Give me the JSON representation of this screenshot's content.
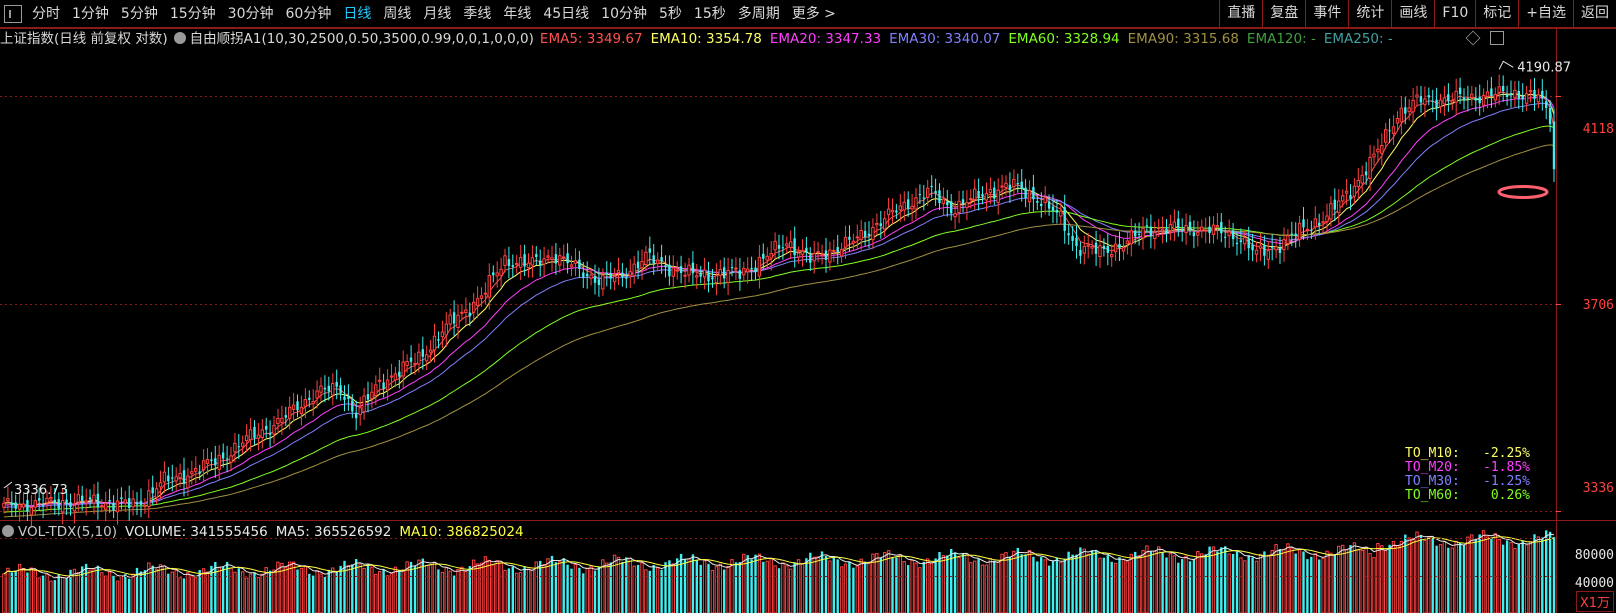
{
  "toolbar": {
    "timeframes": [
      "分时",
      "1分钟",
      "5分钟",
      "15分钟",
      "30分钟",
      "60分钟",
      "日线",
      "周线",
      "月线",
      "季线",
      "年线",
      "45日线",
      "10分钟",
      "5秒",
      "15秒",
      "多周期",
      "更多 >"
    ],
    "active_timeframe": "日线",
    "right_buttons": [
      "直播",
      "复盘",
      "事件",
      "统计",
      "画线",
      "F10",
      "标记",
      "+自选",
      "返回"
    ]
  },
  "main": {
    "security_label": "上证指数(日线 前复权 对数)",
    "indicator_label": "自由顺拐A1(10,30,2500,0.50,3500,0.99,0,0,1,0,0,0)",
    "ema_legend": [
      {
        "label": "EMA5: 3349.67",
        "color": "#ff5050"
      },
      {
        "label": "EMA10: 3354.78",
        "color": "#ffff66"
      },
      {
        "label": "EMA20: 3347.33",
        "color": "#ff40ff"
      },
      {
        "label": "EMA30: 3340.07",
        "color": "#8080ff"
      },
      {
        "label": "EMA60: 3328.94",
        "color": "#80ff20"
      },
      {
        "label": "EMA90: 3315.68",
        "color": "#a09040"
      },
      {
        "label": "EMA120: -",
        "color": "#40a040"
      },
      {
        "label": "EMA250: -",
        "color": "#40a0a0"
      }
    ]
  },
  "volume": {
    "label": "VOL-TDX(5,10)",
    "volume_text": "VOLUME: 341555456",
    "ma5_text": "MA5: 365526592",
    "ma10_text": "MA10: 386825024",
    "ma5_color": "#e8e8e8",
    "ma10_color": "#ffff40",
    "axis_labels": [
      "80000",
      "40000"
    ],
    "unit": "X1万"
  },
  "to_table": [
    {
      "label": "TO_M10:",
      "value": "-2.25%",
      "color": "#ffff66"
    },
    {
      "label": "TO_M20:",
      "value": "-1.85%",
      "color": "#ff40ff"
    },
    {
      "label": "TO_M30:",
      "value": "-1.25%",
      "color": "#8080ff"
    },
    {
      "label": "TO_M60:",
      "value": "0.26%",
      "color": "#80ff20"
    }
  ],
  "colors": {
    "up": "#ff4040",
    "down": "#40f0f0",
    "grid": "#8b1a1a"
  },
  "chart_data": {
    "type": "candlestick",
    "y_scale": "log",
    "ylim": [
      3325,
      4215
    ],
    "ytick_labels": [
      "4118",
      "3706",
      "3336"
    ],
    "high_annotation": "4190.87",
    "low_annotation": "3336.73",
    "keypoints": [
      [
        0,
        3345
      ],
      [
        10,
        3350
      ],
      [
        20,
        3353
      ],
      [
        28,
        3351
      ],
      [
        34,
        3346
      ],
      [
        40,
        3385
      ],
      [
        45,
        3395
      ],
      [
        55,
        3425
      ],
      [
        62,
        3460
      ],
      [
        70,
        3490
      ],
      [
        80,
        3545
      ],
      [
        86,
        3550
      ],
      [
        90,
        3505
      ],
      [
        96,
        3560
      ],
      [
        106,
        3605
      ],
      [
        114,
        3670
      ],
      [
        122,
        3720
      ],
      [
        128,
        3790
      ],
      [
        134,
        3780
      ],
      [
        140,
        3800
      ],
      [
        146,
        3775
      ],
      [
        152,
        3750
      ],
      [
        158,
        3760
      ],
      [
        164,
        3795
      ],
      [
        170,
        3775
      ],
      [
        176,
        3760
      ],
      [
        182,
        3762
      ],
      [
        188,
        3765
      ],
      [
        194,
        3790
      ],
      [
        200,
        3825
      ],
      [
        206,
        3790
      ],
      [
        212,
        3810
      ],
      [
        218,
        3830
      ],
      [
        224,
        3865
      ],
      [
        230,
        3895
      ],
      [
        236,
        3925
      ],
      [
        242,
        3890
      ],
      [
        248,
        3910
      ],
      [
        254,
        3930
      ],
      [
        258,
        3935
      ],
      [
        264,
        3910
      ],
      [
        270,
        3870
      ],
      [
        274,
        3815
      ],
      [
        280,
        3805
      ],
      [
        286,
        3820
      ],
      [
        292,
        3850
      ],
      [
        298,
        3850
      ],
      [
        304,
        3850
      ],
      [
        310,
        3845
      ],
      [
        316,
        3830
      ],
      [
        320,
        3800
      ],
      [
        326,
        3820
      ],
      [
        332,
        3850
      ],
      [
        338,
        3875
      ],
      [
        344,
        3925
      ],
      [
        350,
        3990
      ],
      [
        356,
        4080
      ],
      [
        362,
        4110
      ],
      [
        368,
        4110
      ],
      [
        374,
        4115
      ],
      [
        380,
        4120
      ],
      [
        386,
        4125
      ],
      [
        392,
        4115
      ],
      [
        396,
        4060
      ]
    ],
    "volume_ylim": [
      0,
      100000
    ],
    "volume_unit": "万"
  }
}
